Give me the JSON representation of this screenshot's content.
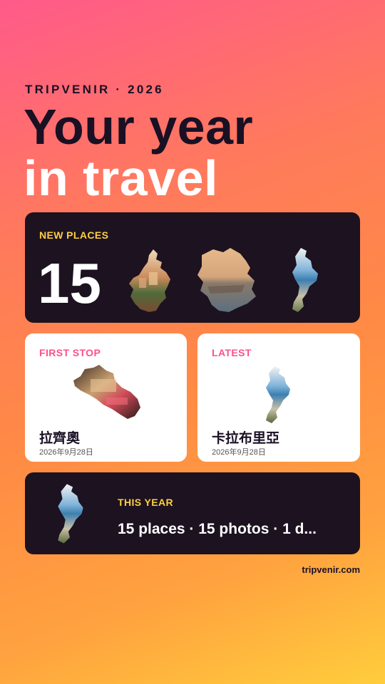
{
  "brand": "TRIPVENIR · 2026",
  "hero": {
    "line1": "Your year",
    "line2": "in travel"
  },
  "new_places": {
    "label": "NEW PLACES",
    "count": "15"
  },
  "first_stop": {
    "label": "FIRST STOP",
    "name": "拉齊奧",
    "date": "2026年9月28日"
  },
  "latest": {
    "label": "LATEST",
    "name": "卡拉布里亞",
    "date": "2026年9月28日"
  },
  "this_year": {
    "label": "THIS YEAR",
    "summary": "15 places · 15 photos · 1 d..."
  },
  "footer": {
    "site": "tripvenir.com"
  },
  "colors": {
    "accent_yellow": "#ffcf3f",
    "accent_pink": "#ff4f8b",
    "dark_card": "#1c1220"
  }
}
